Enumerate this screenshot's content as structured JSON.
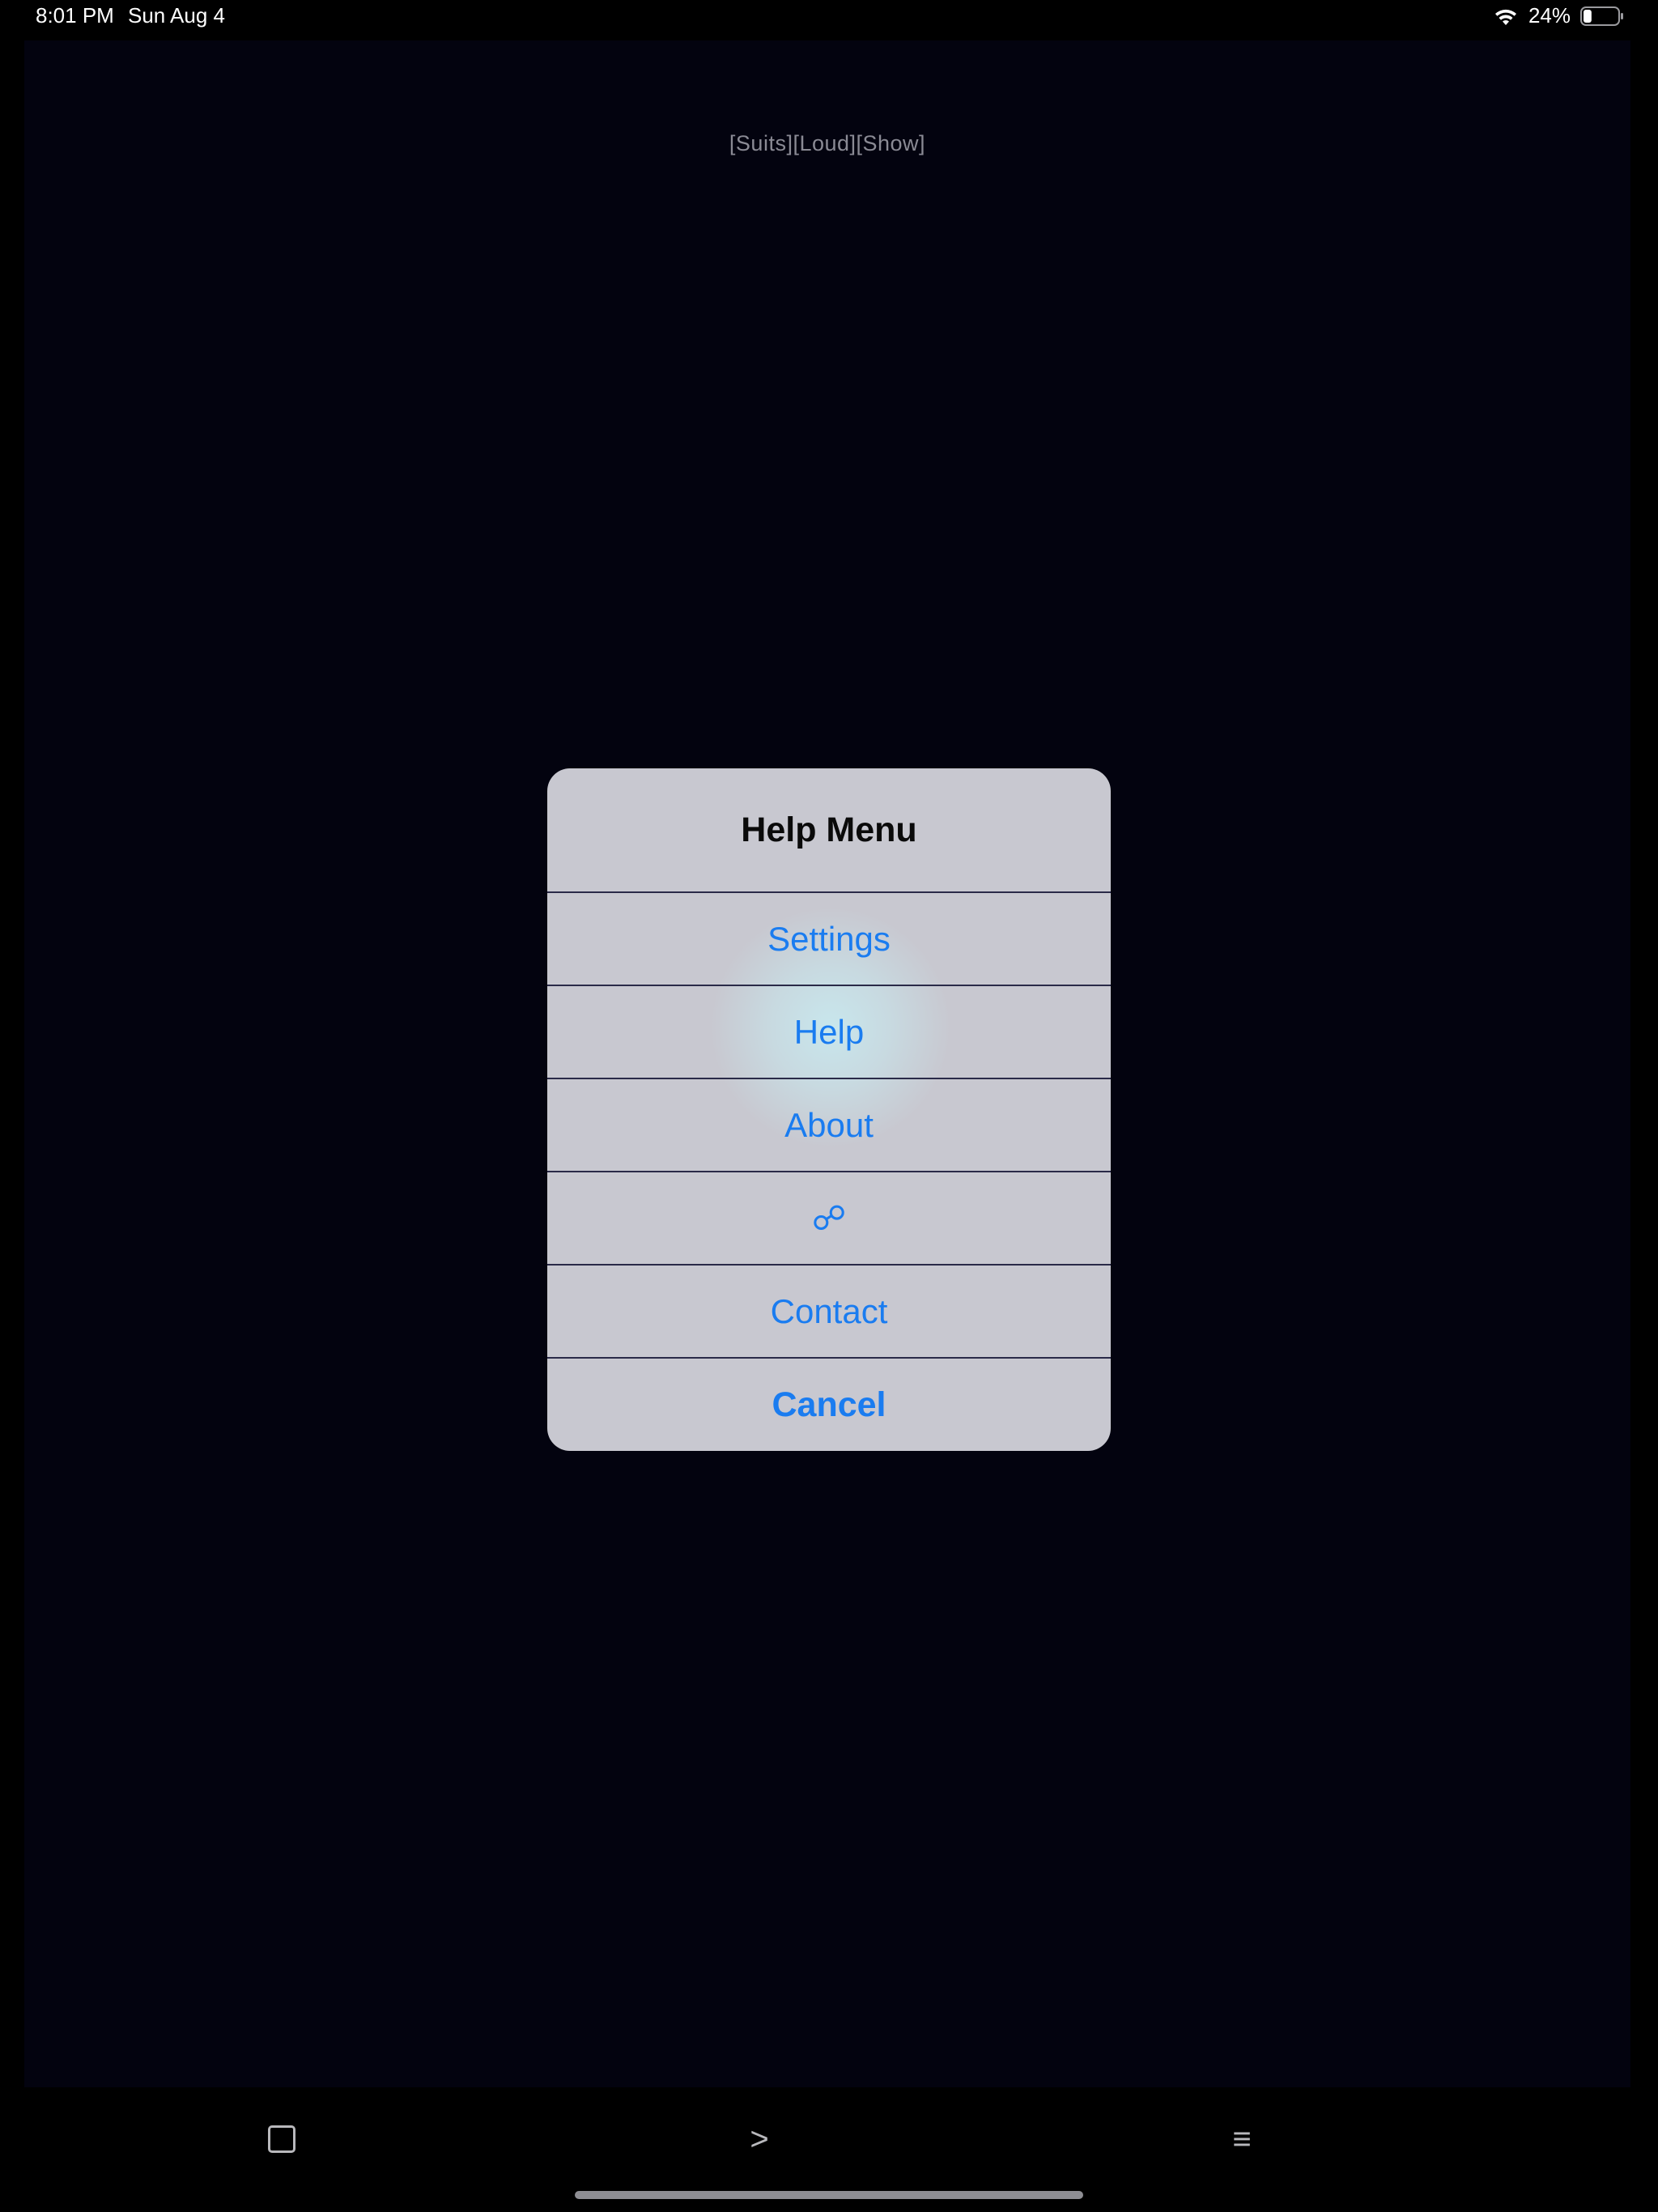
{
  "status_bar": {
    "time": "8:01 PM",
    "date": "Sun Aug 4",
    "battery_percent": "24%",
    "battery_level": 0.24,
    "icons": [
      "wifi-icon",
      "battery-icon"
    ]
  },
  "app": {
    "top_label": "[Suits][Loud][Show]",
    "background_color": "#03030f"
  },
  "dialog": {
    "title": "Help Menu",
    "items": [
      {
        "label": "Settings"
      },
      {
        "label": "Help"
      },
      {
        "label": "About"
      },
      {
        "label": "☍",
        "icon": "link-icon"
      },
      {
        "label": "Contact"
      }
    ],
    "cancel_label": "Cancel",
    "accent_color": "#1a7cf0"
  },
  "toolbar": {
    "items": [
      {
        "icon": "square-icon"
      },
      {
        "label": ">",
        "icon": "next-icon"
      },
      {
        "label": "≡",
        "icon": "menu-icon"
      }
    ]
  }
}
